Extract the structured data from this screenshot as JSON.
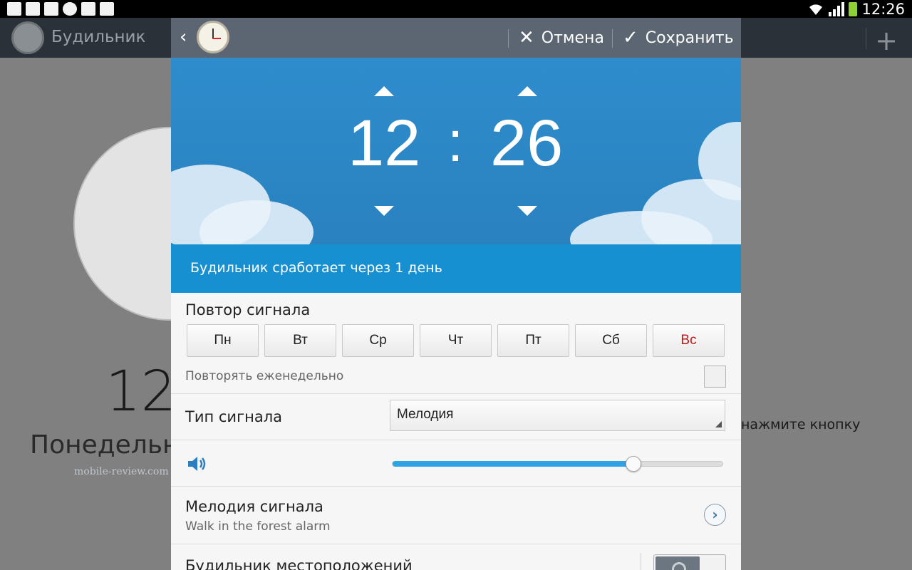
{
  "status_bar": {
    "time": "12:26",
    "left_icons": [
      "sim-card-icon",
      "gallery-icon",
      "gmail-icon",
      "hangouts-icon",
      "tasks-icon",
      "play-store-icon"
    ],
    "right_icons": [
      "wifi-icon",
      "signal-icon",
      "battery-icon"
    ]
  },
  "background_app": {
    "title": "Будильник",
    "big_time": "12",
    "day_text": "Понедельн",
    "hint_text": "нажмите кнопку",
    "watermark": "mobile-review.com"
  },
  "dialog": {
    "cancel_label": "Отмена",
    "save_label": "Сохранить",
    "hours": "12",
    "minutes": "26",
    "separator": ":",
    "notice": "Будильник сработает через 1 день",
    "repeat": {
      "title": "Повтор сигнала",
      "days": [
        "Пн",
        "Вт",
        "Ср",
        "Чт",
        "Пт",
        "Сб",
        "Вс"
      ],
      "weekly_label": "Повторять еженедельно",
      "weekly_checked": false
    },
    "alarm_type": {
      "label": "Тип сигнала",
      "selected": "Мелодия"
    },
    "volume": {
      "level": 0.73
    },
    "melody": {
      "title": "Мелодия сигнала",
      "value": "Walk in the forest alarm"
    },
    "location": {
      "title": "Будильник местоположений",
      "enabled": false
    }
  },
  "colors": {
    "accent_blue": "#1790d2",
    "sunday_red": "#c11818",
    "actionbar": "#5b6672",
    "slider_fill": "#2fa3e6"
  }
}
